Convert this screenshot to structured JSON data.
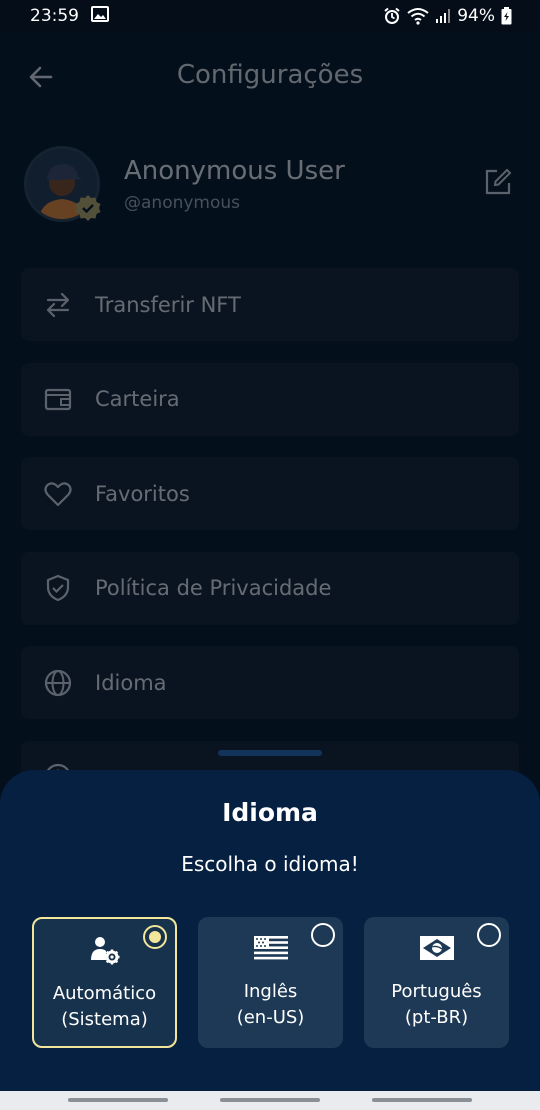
{
  "status_bar": {
    "time": "23:59",
    "battery": "94%",
    "icons": [
      "image-icon",
      "alarm-icon",
      "wifi-icon",
      "signal-icon",
      "battery-icon"
    ]
  },
  "header": {
    "title": "Configurações",
    "back_icon": "arrow-left-icon"
  },
  "profile": {
    "name": "Anonymous User",
    "handle": "@anonymous",
    "edit_icon": "edit-icon"
  },
  "menu": {
    "items": [
      {
        "label": "Transferir NFT",
        "icon": "transfer-arrows-icon"
      },
      {
        "label": "Carteira",
        "icon": "wallet-icon"
      },
      {
        "label": "Favoritos",
        "icon": "heart-icon"
      },
      {
        "label": "Política de Privacidade",
        "icon": "shield-check-icon"
      },
      {
        "label": "Idioma",
        "icon": "globe-icon"
      },
      {
        "label": "",
        "icon": "info-icon"
      }
    ]
  },
  "sheet": {
    "title": "Idioma",
    "subtitle": "Escolha o idioma!",
    "options": [
      {
        "line1": "Automático",
        "line2": "(Sistema)",
        "icon": "user-gear-icon",
        "selected": true
      },
      {
        "line1": "Inglês",
        "line2": "(en-US)",
        "icon": "us-flag-icon",
        "selected": false
      },
      {
        "line1": "Português",
        "line2": "(pt-BR)",
        "icon": "brazil-flag-icon",
        "selected": false
      }
    ]
  },
  "colors": {
    "background": "#08192b",
    "card": "#142536",
    "sheet": "#062041",
    "option": "#1e3955",
    "accent": "#f2e69a"
  }
}
